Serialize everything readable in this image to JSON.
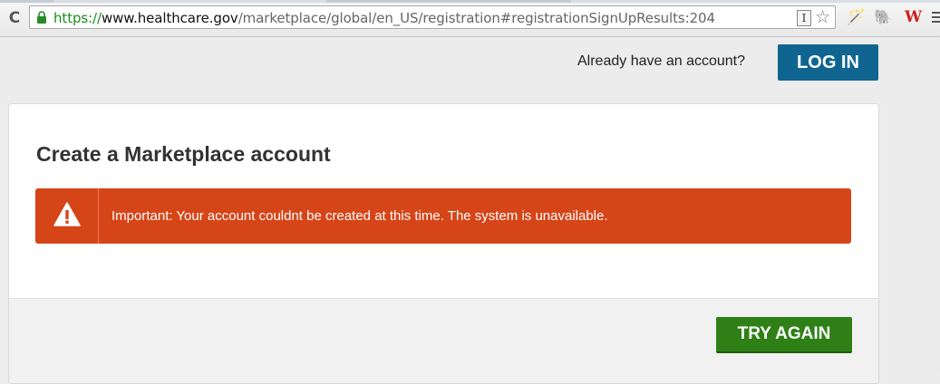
{
  "browser": {
    "url_scheme": "https://",
    "url_host": "www.healthcare.gov",
    "url_path": "/marketplace/global/en_US/registration#registrationSignUpResults:204",
    "reader_glyph": "I",
    "star_glyph": "☆",
    "extensions": [
      {
        "name": "wand-extension-icon",
        "glyph": "🪄"
      },
      {
        "name": "elephant-extension-icon",
        "glyph": "🐘"
      },
      {
        "name": "w-extension-icon",
        "glyph": "W"
      }
    ],
    "reload_glyph": "C"
  },
  "header": {
    "already_text": "Already have an account?",
    "login_label": "LOG IN"
  },
  "card": {
    "title": "Create a Marketplace account",
    "alert_message": "Important: Your account couldnt be created at this time. The system is unavailable.",
    "try_again_label": "TRY AGAIN"
  },
  "colors": {
    "login_button": "#0f6590",
    "alert_background": "#d64518",
    "try_again_button": "#2e8016"
  }
}
